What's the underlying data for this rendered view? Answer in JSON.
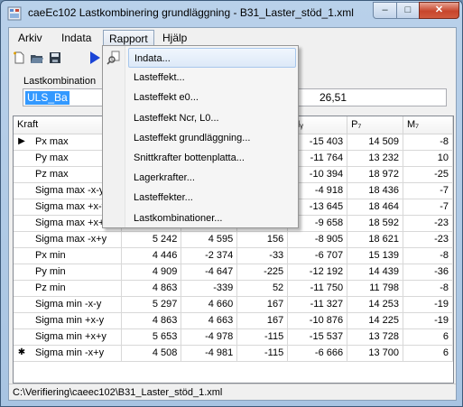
{
  "window": {
    "title": "caeEc102 Lastkombinering grundläggning  -  B31_Laster_stöd_1.xml",
    "minimize": "–",
    "maximize": "□",
    "close": "✕"
  },
  "menu": {
    "items": [
      "Arkiv",
      "Indata",
      "Rapport",
      "Hjälp"
    ],
    "active": "Rapport"
  },
  "toolbar": {
    "icons": [
      "new-file-icon",
      "open-folder-icon",
      "save-icon",
      "run-play-icon",
      "preview-icon"
    ]
  },
  "load_combination": {
    "label": "Lastkombination",
    "value": "ULS_Ba",
    "number": "26,51"
  },
  "grid": {
    "headers": [
      "Kraft",
      "",
      "",
      "",
      "Mᵧ",
      "P₇",
      "M₇"
    ],
    "rows": [
      {
        "marker": "▶",
        "name": "Px max",
        "c1": "",
        "c2": "",
        "c3": "",
        "c4": "-15 403",
        "c5": "14 509",
        "c6": "-8"
      },
      {
        "marker": "",
        "name": "Py max",
        "c1": "",
        "c2": "",
        "c3": "",
        "c4": "-11 764",
        "c5": "13 232",
        "c6": "10"
      },
      {
        "marker": "",
        "name": "Pz max",
        "c1": "",
        "c2": "",
        "c3": "",
        "c4": "-10 394",
        "c5": "18 972",
        "c6": "-25"
      },
      {
        "marker": "",
        "name": "Sigma max -x-y",
        "c1": "",
        "c2": "",
        "c3": "",
        "c4": "-4 918",
        "c5": "18 436",
        "c6": "-7"
      },
      {
        "marker": "",
        "name": "Sigma max +x-y",
        "c1": "",
        "c2": "",
        "c3": "",
        "c4": "-13 645",
        "c5": "18 464",
        "c6": "-7"
      },
      {
        "marker": "",
        "name": "Sigma max +x+y",
        "c1": "",
        "c2": "",
        "c3": "",
        "c4": "-9 658",
        "c5": "18 592",
        "c6": "-23"
      },
      {
        "marker": "",
        "name": "Sigma max -x+y",
        "c1": "5 242",
        "c2": "4 595",
        "c3": "156",
        "c4": "-8 905",
        "c5": "18 621",
        "c6": "-23"
      },
      {
        "marker": "",
        "name": "Px min",
        "c1": "4 446",
        "c2": "-2 374",
        "c3": "-33",
        "c4": "-6 707",
        "c5": "15 139",
        "c6": "-8"
      },
      {
        "marker": "",
        "name": "Py min",
        "c1": "4 909",
        "c2": "-4 647",
        "c3": "-225",
        "c4": "-12 192",
        "c5": "14 439",
        "c6": "-36"
      },
      {
        "marker": "",
        "name": "Pz min",
        "c1": "4 863",
        "c2": "-339",
        "c3": "52",
        "c4": "-11 750",
        "c5": "11 798",
        "c6": "-8"
      },
      {
        "marker": "",
        "name": "Sigma min -x-y",
        "c1": "5 297",
        "c2": "4 660",
        "c3": "167",
        "c4": "-11 327",
        "c5": "14 253",
        "c6": "-19"
      },
      {
        "marker": "",
        "name": "Sigma min +x-y",
        "c1": "4 863",
        "c2": "4 663",
        "c3": "167",
        "c4": "-10 876",
        "c5": "14 225",
        "c6": "-19"
      },
      {
        "marker": "",
        "name": "Sigma min +x+y",
        "c1": "5 653",
        "c2": "-4 978",
        "c3": "-115",
        "c4": "-15 537",
        "c5": "13 728",
        "c6": "6"
      },
      {
        "marker": "✱",
        "name": "Sigma min -x+y",
        "c1": "4 508",
        "c2": "-4 981",
        "c3": "-115",
        "c4": "-6 666",
        "c5": "13 700",
        "c6": "6"
      }
    ]
  },
  "rapport_menu": [
    "Indata...",
    "Lasteffekt...",
    "Lasteffekt e0...",
    "Lasteffekt Ncr, L0...",
    "Lasteffekt grundläggning...",
    "Snittkrafter bottenplatta...",
    "Lagerkrafter...",
    "Lasteffekter...",
    "Lastkombinationer..."
  ],
  "status": {
    "path": "C:\\Verifiering\\caeec102\\B31_Laster_stöd_1.xml"
  }
}
